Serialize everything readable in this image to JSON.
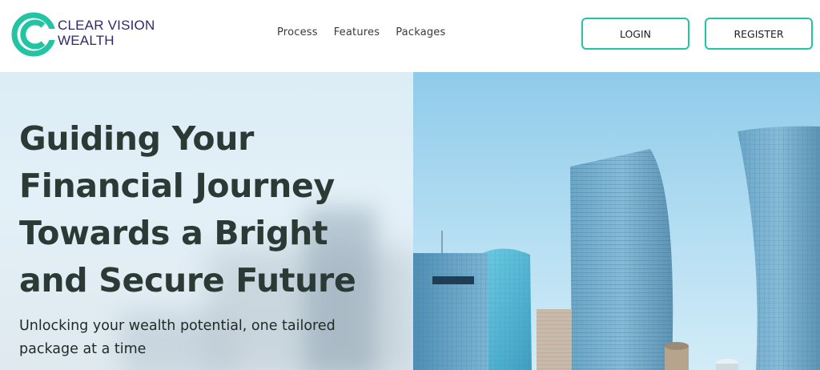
{
  "brand": {
    "name_line1": "CLEAR VISION",
    "name_line2": "WEALTH",
    "logo_icon": "c-ring-logo-icon",
    "colors": {
      "accent": "#23c4a4",
      "brand_text": "#2f2a6b"
    }
  },
  "nav": {
    "items": [
      {
        "label": "Process"
      },
      {
        "label": "Features"
      },
      {
        "label": "Packages"
      }
    ]
  },
  "header": {
    "login_label": "LOGIN",
    "register_label": "REGISTER"
  },
  "hero": {
    "headline": [
      "Guiding Your",
      "Financial Journey",
      "Towards a Bright",
      "and Secure Future"
    ],
    "subline": [
      "Unlocking your wealth potential, one tailored",
      "package at a time"
    ],
    "image": "city-skyscrapers-image"
  }
}
